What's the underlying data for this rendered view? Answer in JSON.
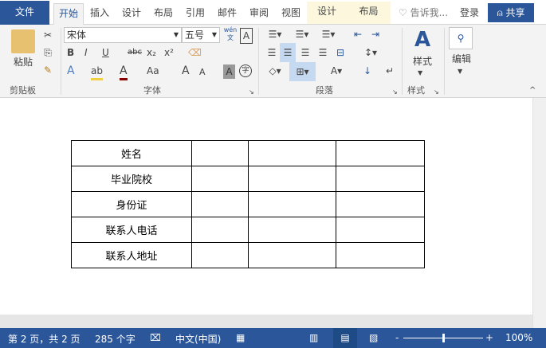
{
  "tabs": {
    "file": "文件",
    "items": [
      "开始",
      "插入",
      "设计",
      "布局",
      "引用",
      "邮件",
      "审阅",
      "视图"
    ],
    "context": [
      "设计",
      "布局"
    ],
    "tell_me": "告诉我...",
    "login": "登录",
    "share": "共享"
  },
  "ribbon": {
    "clipboard": {
      "paste": "粘贴",
      "group": "剪贴板"
    },
    "font": {
      "name": "宋体",
      "size": "五号",
      "bold": "B",
      "italic": "I",
      "underline": "U",
      "strike": "abc",
      "sub": "x₂",
      "sup": "x²",
      "case": "Aa",
      "grow": "A",
      "shrink": "A",
      "group": "字体",
      "phonetic": "wén 文",
      "border_char": "A",
      "shade_char": "A",
      "enclose": "字"
    },
    "paragraph": {
      "group": "段落"
    },
    "styles": {
      "label": "样式",
      "group": "样式"
    },
    "editing": {
      "label": "编辑"
    }
  },
  "table": [
    [
      "姓名",
      "",
      "",
      ""
    ],
    [
      "毕业院校",
      "",
      "",
      ""
    ],
    [
      "身份证",
      "",
      "",
      ""
    ],
    [
      "联系人电话",
      "",
      "",
      ""
    ],
    [
      "联系人地址",
      "",
      "",
      ""
    ]
  ],
  "status": {
    "page": "第 2 页，共 2 页",
    "words": "285 个字",
    "language": "中文(中国)",
    "zoom": "100%"
  },
  "colors": {
    "accent": "#2b579a"
  }
}
